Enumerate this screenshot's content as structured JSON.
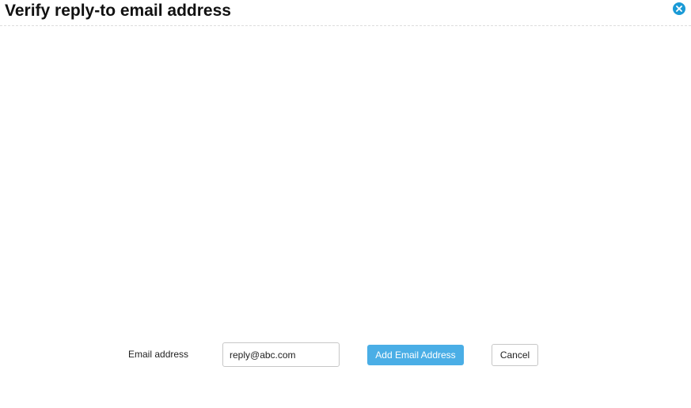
{
  "dialog": {
    "title": "Verify reply-to email address",
    "close_icon": "close-icon",
    "accent_color": "#1a9ad6"
  },
  "form": {
    "email_label": "Email address",
    "email_value": "reply@abc.com",
    "add_button_label": "Add Email Address",
    "add_button_color": "#4aaee6",
    "cancel_button_label": "Cancel"
  }
}
